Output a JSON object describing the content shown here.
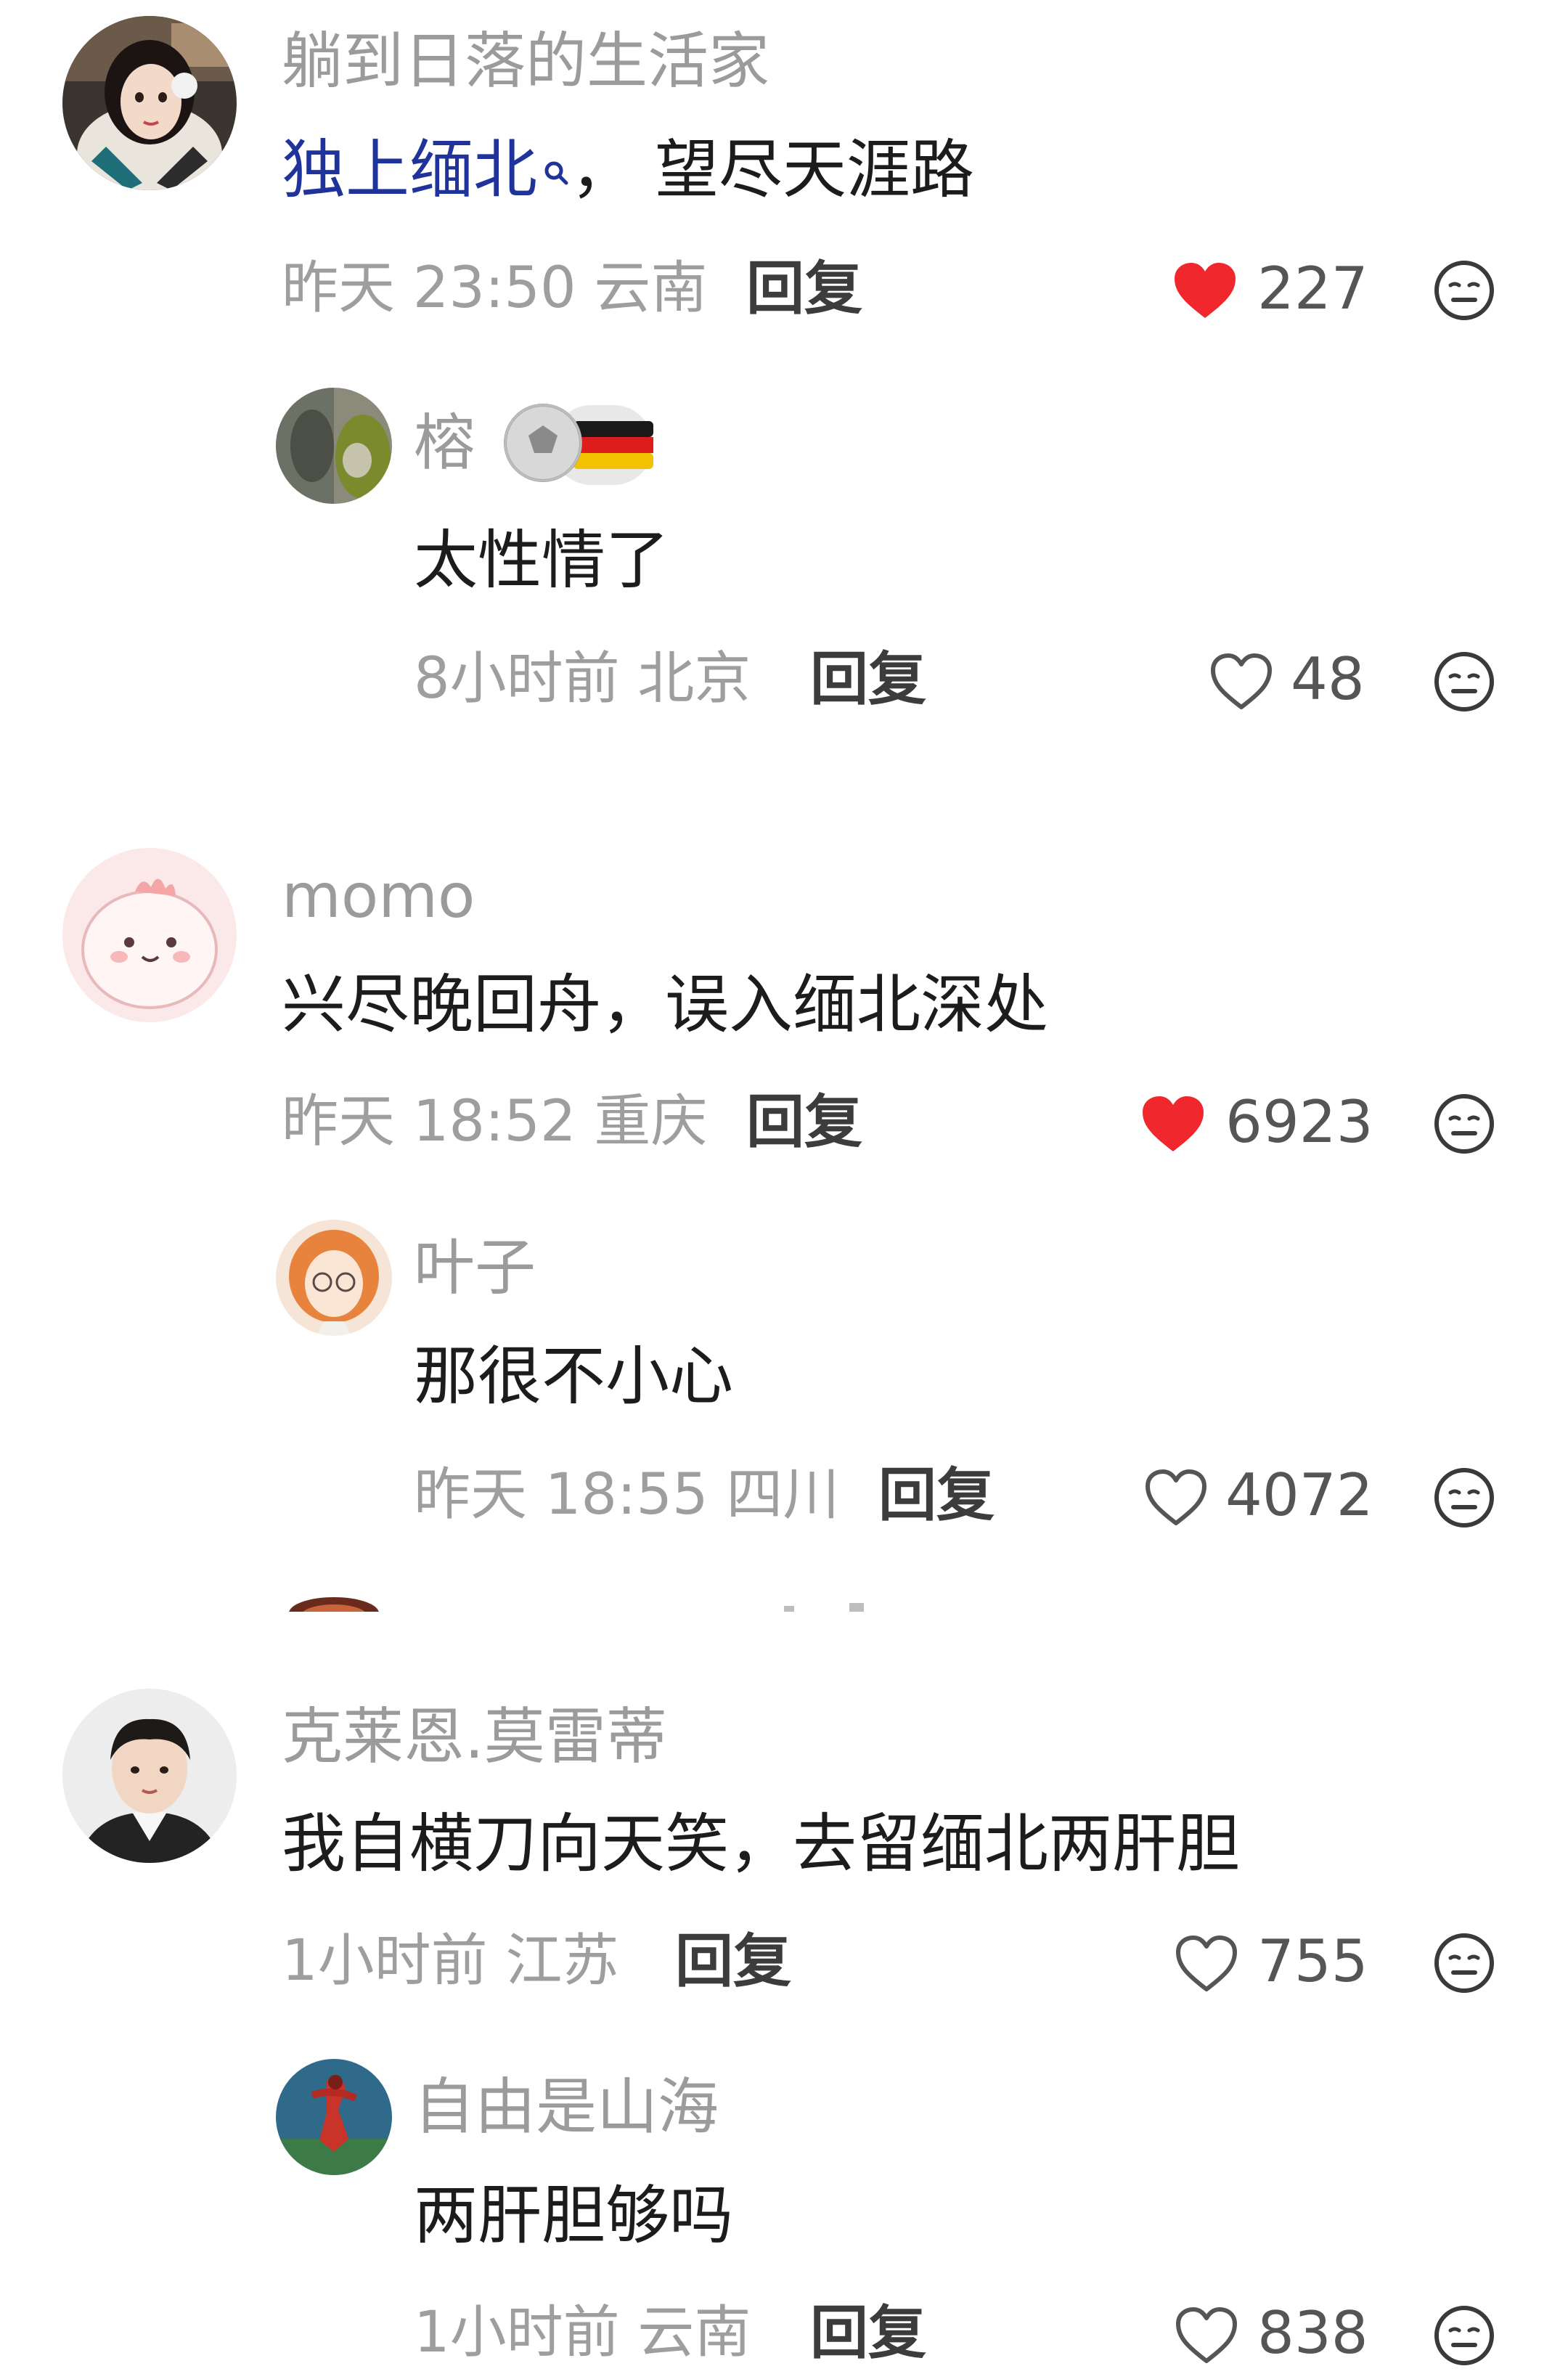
{
  "colors": {
    "username": "#9b9b9b",
    "content": "#1c1c1c",
    "meta": "#9e9e9e",
    "reply": "#3c3c3c",
    "liked_heart": "#f0282d",
    "link": "#20339b"
  },
  "comments": [
    {
      "username": "躺到日落的生活家",
      "content_link": "独上缅北",
      "content_rest": "，  望尽天涯路",
      "time": "昨天 23:50 云南",
      "reply_label": "回复",
      "likes": "227",
      "liked": true,
      "dislike_icon": "neutral-face-icon",
      "replies": [
        {
          "username": "榕",
          "badge": "football-germany-flag-badge",
          "content": "太性情了",
          "time": "8小时前 北京",
          "reply_label": "回复",
          "likes": "48",
          "liked": false
        }
      ]
    },
    {
      "username": "momo",
      "content": "兴尽晚回舟，误入缅北深处",
      "time": "昨天 18:52 重庆",
      "reply_label": "回复",
      "likes": "6923",
      "liked": true,
      "replies": [
        {
          "username": "叶子",
          "content": "那很不小心",
          "time": "昨天 18:55 四川",
          "reply_label": "回复",
          "likes": "4072",
          "liked": false
        }
      ]
    },
    {
      "username": "克莱恩.莫雷蒂",
      "content": "我自横刀向天笑，去留缅北两肝胆",
      "time": "1小时前 江苏",
      "reply_label": "回复",
      "likes": "755",
      "liked": false,
      "replies": [
        {
          "username": "自由是山海",
          "content": "两肝胆够吗",
          "time": "1小时前 云南",
          "reply_label": "回复",
          "likes": "838",
          "liked": false
        }
      ]
    }
  ]
}
